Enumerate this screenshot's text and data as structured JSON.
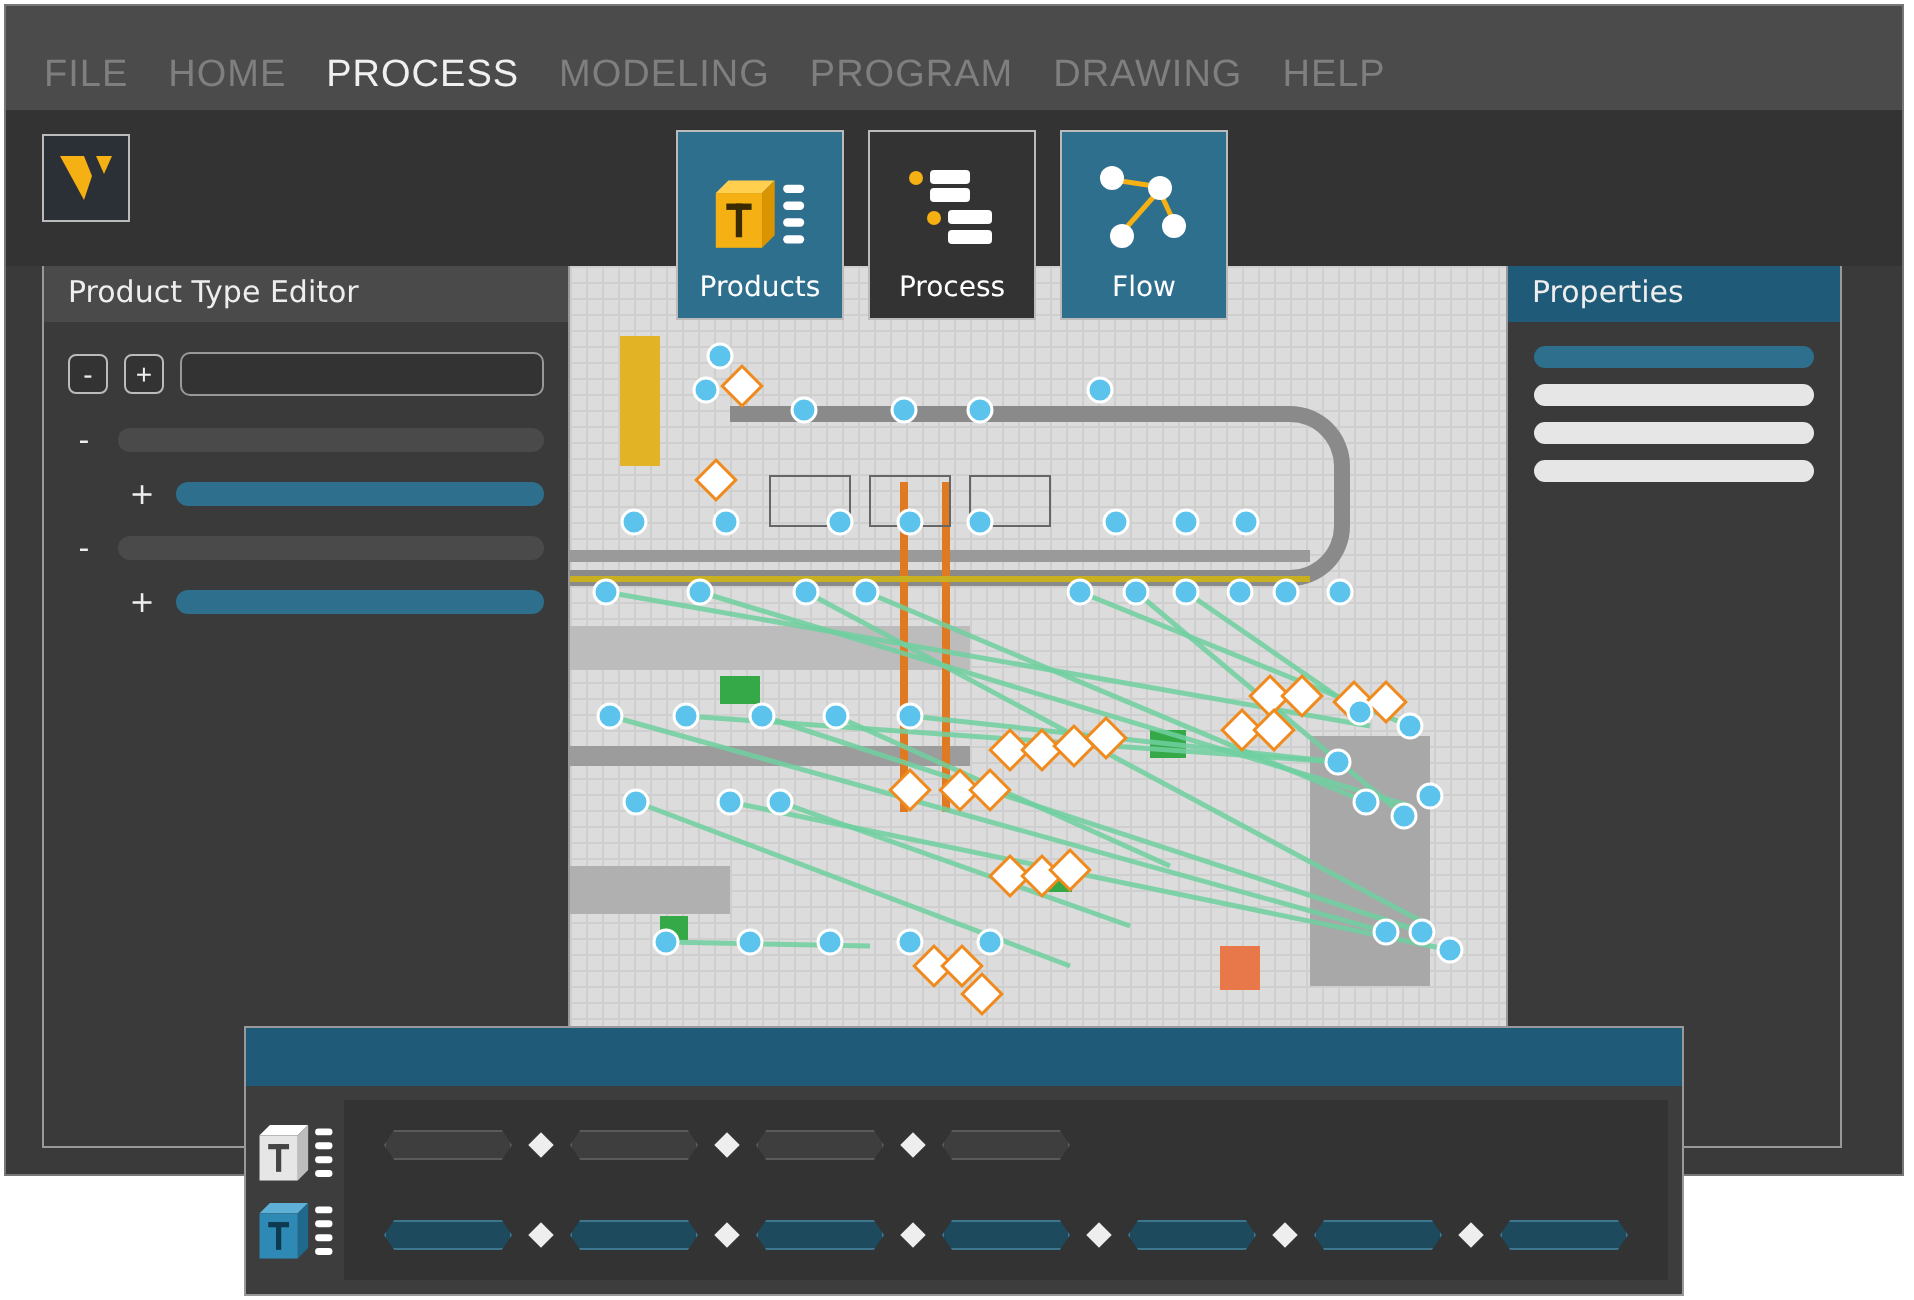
{
  "menu": [
    {
      "label": "FILE",
      "selected": false
    },
    {
      "label": "HOME",
      "selected": false
    },
    {
      "label": "PROCESS",
      "selected": true
    },
    {
      "label": "MODELING",
      "selected": false
    },
    {
      "label": "PROGRAM",
      "selected": false
    },
    {
      "label": "DRAWING",
      "selected": false
    },
    {
      "label": "HELP",
      "selected": false
    }
  ],
  "ribbon": [
    {
      "label": "Products",
      "kind": "products",
      "selected": true
    },
    {
      "label": "Process",
      "kind": "process",
      "selected": false
    },
    {
      "label": "Flow",
      "kind": "flow",
      "selected": true
    }
  ],
  "product_type_editor": {
    "title": "Product Type Editor",
    "buttons": [
      "-",
      "+"
    ],
    "tree": [
      {
        "toggle": "-",
        "selected": false,
        "children": [
          {
            "toggle": "+",
            "selected": true
          }
        ]
      },
      {
        "toggle": "-",
        "selected": false,
        "children": [
          {
            "toggle": "+",
            "selected": true
          }
        ]
      }
    ]
  },
  "properties": {
    "title": "Properties",
    "rows": [
      {
        "selected": true
      },
      {
        "selected": false
      },
      {
        "selected": false
      },
      {
        "selected": false
      }
    ]
  },
  "sequence_panel": {
    "rows": [
      {
        "selected": false,
        "steps": [
          {
            "selected": false
          },
          {
            "selected": false
          },
          {
            "selected": false
          },
          {
            "selected": false
          }
        ]
      },
      {
        "selected": true,
        "steps": [
          {
            "selected": true
          },
          {
            "selected": true
          },
          {
            "selected": true
          },
          {
            "selected": true
          },
          {
            "selected": true
          },
          {
            "selected": true
          },
          {
            "selected": true
          }
        ]
      }
    ]
  }
}
